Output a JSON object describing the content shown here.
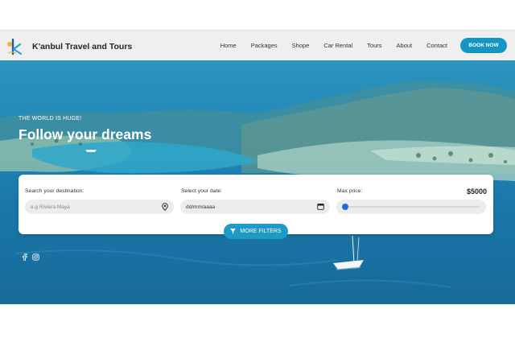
{
  "brand": {
    "name": "K'anbul Travel and Tours",
    "logo_letter": "k"
  },
  "nav": {
    "items": [
      {
        "label": "Home"
      },
      {
        "label": "Packages"
      },
      {
        "label": "Shope"
      },
      {
        "label": "Car Rental"
      },
      {
        "label": "Tours"
      },
      {
        "label": "About"
      },
      {
        "label": "Contact"
      }
    ],
    "cta_label": "BOOK NOW"
  },
  "hero": {
    "tagline": "THE WORLD IS HUGE!",
    "headline": "Follow your dreams"
  },
  "search": {
    "destination_label": "Search your destination:",
    "destination_placeholder": "e.g Riviera Maya",
    "date_label": "Select your date:",
    "date_value": "dd/mm/aaaa",
    "price_label": "Max price:",
    "price_value": "$5000",
    "price_level": 0.0,
    "filters_label": "MORE FILTERS"
  },
  "social": {
    "icons": [
      "facebook-icon",
      "instagram-icon"
    ]
  },
  "colors": {
    "accent": "#1496c5",
    "hero": "#2087b6",
    "slider": "#1b6fe0"
  }
}
